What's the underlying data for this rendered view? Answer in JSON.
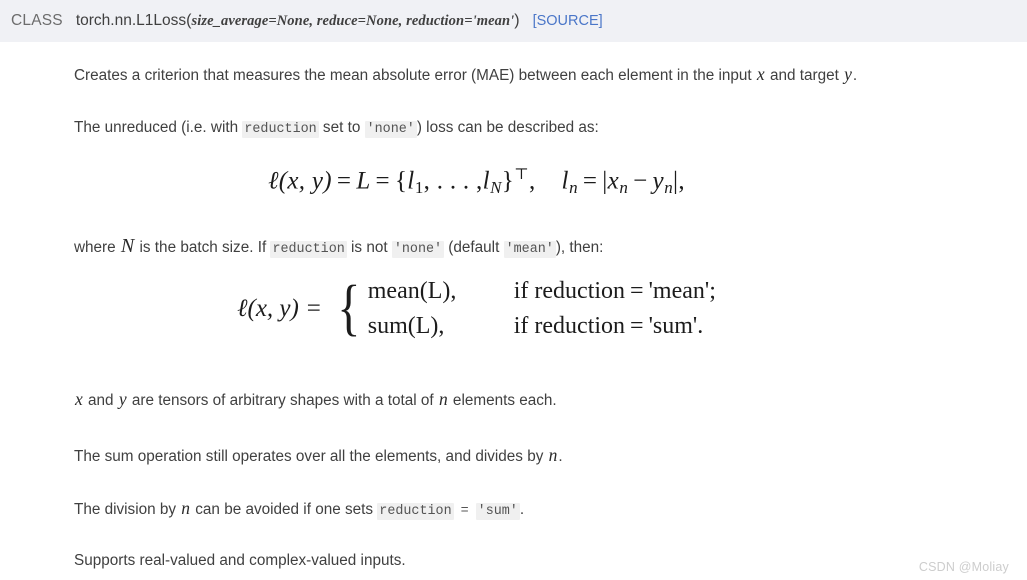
{
  "signature": {
    "class_keyword": "CLASS",
    "qualified_name": "torch.nn.L1Loss",
    "open_paren": "(",
    "close_paren": ")",
    "params_text": "size_average=None, reduce=None, reduction='mean'",
    "params": [
      {
        "name": "size_average",
        "value": "None"
      },
      {
        "name": "reduce",
        "value": "None"
      },
      {
        "name": "reduction",
        "value": "'mean'"
      }
    ],
    "source_link": "[SOURCE]",
    "band_color": "#f0f1f5",
    "link_color": "#4a76c8"
  },
  "body": {
    "p1": {
      "part1": "Creates a criterion that measures the mean absolute error (MAE) between each element in the input ",
      "var_x": "x",
      "part2": " and target ",
      "var_y": "y",
      "part3": "."
    },
    "p2": {
      "part1": "The unreduced (i.e. with ",
      "code1": "reduction",
      "part2": " set to ",
      "code2": "'none'",
      "part3": ") loss can be described as:"
    },
    "p3": {
      "part1": "where ",
      "var_N": "N",
      "part2": " is the batch size. If ",
      "code1": "reduction",
      "part3": " is not ",
      "code2": "'none'",
      "part4": " (default ",
      "code3": "'mean'",
      "part5": "), then:"
    },
    "p4": {
      "var_x": "x",
      "part1": " and ",
      "var_y": "y",
      "part2": " are tensors of arbitrary shapes with a total of ",
      "var_n": "n",
      "part3": " elements each."
    },
    "p5": {
      "part1": "The sum operation still operates over all the elements, and divides by ",
      "var_n": "n",
      "part2": "."
    },
    "p6": {
      "part1": "The division by ",
      "var_n": "n",
      "part2": " can be avoided if one sets ",
      "code1": "reduction",
      "code_eq": "=",
      "code2": "'sum'",
      "part3": "."
    },
    "p7": {
      "text": "Supports real-valued and complex-valued inputs."
    }
  },
  "equations": {
    "eq1": {
      "latex": "\\ell(x,y) = L = \\{l_1,\\dots,l_N\\}^\\top,\\quad l_n = |x_n - y_n|,",
      "lhs": "ℓ(x, y)",
      "eq_sign": "=",
      "L": "L",
      "set_open": "{",
      "l_one": "l",
      "l_one_sub": "1",
      "dots": ", . . . ,",
      "l_N": "l",
      "l_N_sub": "N",
      "set_close": "}",
      "transpose": "⊤",
      "comma": ",",
      "second_l": "l",
      "second_l_sub": "n",
      "second_eq": "=",
      "abs_open": "|",
      "x_n": "x",
      "x_n_sub": "n",
      "minus": "−",
      "y_n": "y",
      "y_n_sub": "n",
      "abs_close": "|",
      "trailing_comma": ","
    },
    "eq2": {
      "latex": "\\ell(x,y) = \\begin{cases} \\mathrm{mean}(L), & \\text{if reduction} = \\text{'mean'}; \\\\ \\mathrm{sum}(L), & \\text{if reduction} = \\text{'sum'}. \\end{cases}",
      "lhs": "ℓ(x, y)  =",
      "rows": [
        {
          "value": "mean(L),",
          "condition_prefix": "if reduction",
          "eq": "=",
          "condition_value": "'mean';"
        },
        {
          "value": "sum(L),",
          "condition_prefix": "if reduction",
          "eq": "=",
          "condition_value": "'sum'."
        }
      ]
    }
  },
  "watermark": {
    "text": "CSDN @Moliay",
    "color": "#cdcdcd"
  }
}
